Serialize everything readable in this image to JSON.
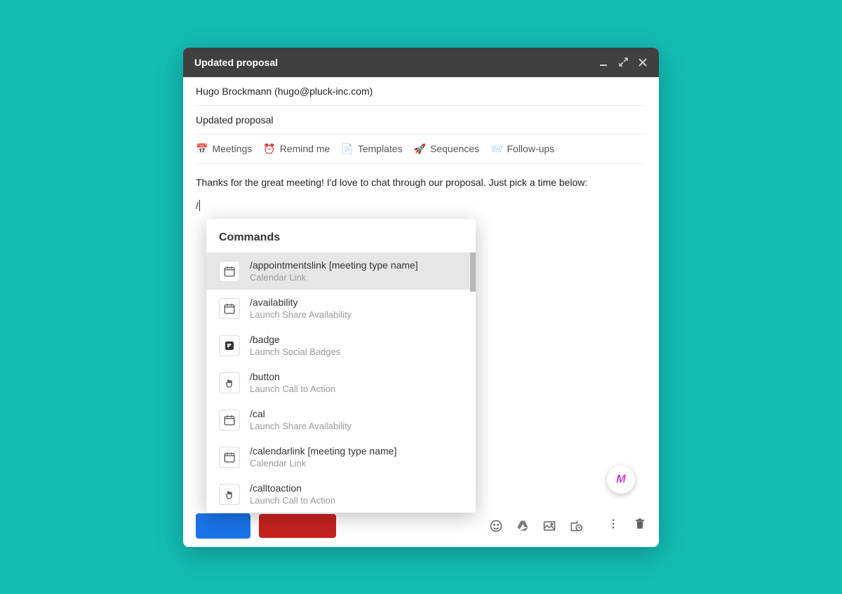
{
  "window": {
    "title": "Updated proposal"
  },
  "recipient": "Hugo Brockmann (hugo@pluck-inc.com)",
  "subject": "Updated proposal",
  "toolbar": {
    "meetings": "Meetings",
    "remind": "Remind me",
    "templates": "Templates",
    "sequences": "Sequences",
    "followups": "Follow-ups"
  },
  "body": "Thanks for the great meeting! I'd love to chat through our proposal. Just pick a time below:",
  "slash_input": "/",
  "commands": {
    "header": "Commands",
    "items": [
      {
        "icon": "calendar",
        "title": "/appointmentslink [meeting type name]",
        "sub": "Calendar Link",
        "active": true
      },
      {
        "icon": "calendar",
        "title": "/availability",
        "sub": "Launch Share Availability",
        "active": false
      },
      {
        "icon": "badge",
        "title": "/badge",
        "sub": "Launch Social Badges",
        "active": false
      },
      {
        "icon": "pointer",
        "title": "/button",
        "sub": "Launch Call to Action",
        "active": false
      },
      {
        "icon": "calendar",
        "title": "/cal",
        "sub": "Launch Share Availability",
        "active": false
      },
      {
        "icon": "calendar",
        "title": "/calendarlink [meeting type name]",
        "sub": "Calendar Link",
        "active": false
      },
      {
        "icon": "pointer",
        "title": "/calltoaction",
        "sub": "Launch Call to Action",
        "active": false
      }
    ]
  },
  "fab": "M"
}
